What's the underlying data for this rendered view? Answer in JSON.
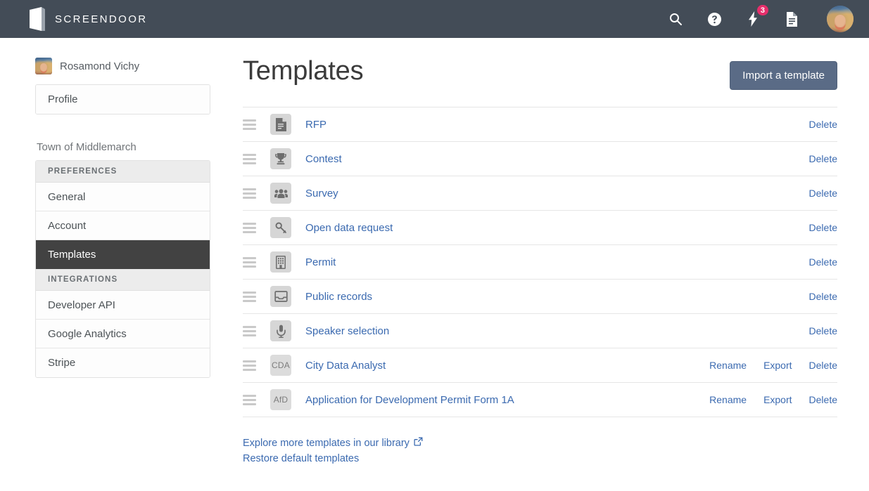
{
  "header": {
    "brand": "SCREENDOOR",
    "icons": [
      {
        "name": "search-icon",
        "label": "Search"
      },
      {
        "name": "help-circle-icon",
        "label": "Help"
      },
      {
        "name": "lightning-bolt-icon",
        "label": "Activity",
        "badge": "3"
      },
      {
        "name": "document-icon",
        "label": "Documents"
      }
    ],
    "avatar_alt": "Rosamond Vichy"
  },
  "sidebar": {
    "user_name": "Rosamond Vichy",
    "profile_label": "Profile",
    "org_label": "Town of Middlemarch",
    "groups": [
      {
        "header": "PREFERENCES",
        "items": [
          {
            "label": "General",
            "active": false
          },
          {
            "label": "Account",
            "active": false
          },
          {
            "label": "Templates",
            "active": true
          }
        ]
      },
      {
        "header": "INTEGRATIONS",
        "items": [
          {
            "label": "Developer API",
            "active": false
          },
          {
            "label": "Google Analytics",
            "active": false
          },
          {
            "label": "Stripe",
            "active": false
          }
        ]
      }
    ]
  },
  "main": {
    "title": "Templates",
    "import_button": "Import a template",
    "templates": [
      {
        "name": "RFP",
        "icon": "file-text-icon",
        "initials": null,
        "actions": [
          "Delete"
        ]
      },
      {
        "name": "Contest",
        "icon": "trophy-icon",
        "initials": null,
        "actions": [
          "Delete"
        ]
      },
      {
        "name": "Survey",
        "icon": "users-icon",
        "initials": null,
        "actions": [
          "Delete"
        ]
      },
      {
        "name": "Open data request",
        "icon": "key-icon",
        "initials": null,
        "actions": [
          "Delete"
        ]
      },
      {
        "name": "Permit",
        "icon": "building-icon",
        "initials": null,
        "actions": [
          "Delete"
        ]
      },
      {
        "name": "Public records",
        "icon": "inbox-icon",
        "initials": null,
        "actions": [
          "Delete"
        ]
      },
      {
        "name": "Speaker selection",
        "icon": "microphone-icon",
        "initials": null,
        "actions": [
          "Delete"
        ]
      },
      {
        "name": "City Data Analyst",
        "icon": "initials-icon",
        "initials": "CDA",
        "actions": [
          "Rename",
          "Export",
          "Delete"
        ]
      },
      {
        "name": "Application for Development Permit Form 1A",
        "icon": "initials-icon",
        "initials": "AfD",
        "actions": [
          "Rename",
          "Export",
          "Delete"
        ]
      }
    ],
    "footer_links": [
      {
        "label": "Explore more templates in our library",
        "external": true
      },
      {
        "label": "Restore default templates",
        "external": false
      }
    ]
  },
  "colors": {
    "topnav_bg": "#434C57",
    "link_blue": "#3b6ab0",
    "button_bg": "#5A6B86",
    "active_nav_bg": "#424242",
    "badge_pink": "#E62E6B"
  }
}
